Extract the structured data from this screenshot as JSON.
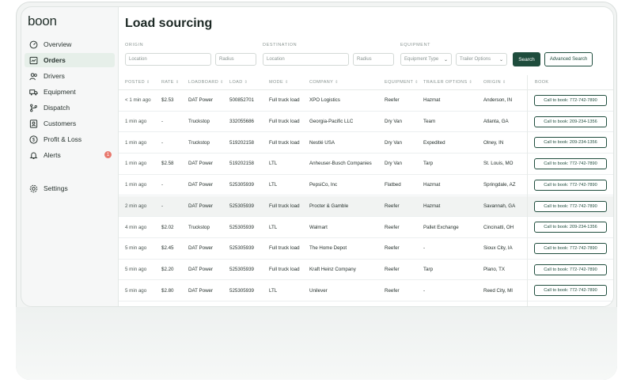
{
  "app": {
    "logo": "boon"
  },
  "sidebar": {
    "items": [
      {
        "label": "Overview",
        "icon": "overview-icon"
      },
      {
        "label": "Orders",
        "icon": "orders-icon",
        "active": true
      },
      {
        "label": "Drivers",
        "icon": "drivers-icon"
      },
      {
        "label": "Equipment",
        "icon": "truck-icon"
      },
      {
        "label": "Dispatch",
        "icon": "dispatch-icon"
      },
      {
        "label": "Customers",
        "icon": "customers-icon"
      },
      {
        "label": "Profit & Loss",
        "icon": "dollar-icon"
      },
      {
        "label": "Alerts",
        "icon": "bell-icon",
        "badge": "1"
      }
    ],
    "settings": {
      "label": "Settings",
      "icon": "gear-icon"
    }
  },
  "main": {
    "title": "Load sourcing",
    "filters": {
      "origin_label": "Origin",
      "destination_label": "Destination",
      "equipment_label": "Equipment",
      "origin_location_placeholder": "Location",
      "origin_radius_placeholder": "Radius",
      "destination_location_placeholder": "Location",
      "destination_radius_placeholder": "Radius",
      "equipment_type": "Equipment Type",
      "trailer_options": "Trailer Options",
      "search_button": "Search",
      "advanced_button": "Advanced Search"
    },
    "columns": [
      "Posted",
      "Rate",
      "Loadboard",
      "Load",
      "Mode",
      "Company",
      "Equipment",
      "Trailer Options",
      "Origin",
      "Book"
    ],
    "rows": [
      {
        "posted": "< 1 min ago",
        "rate": "$2.53",
        "loadboard": "DAT Power",
        "load": "500852701",
        "mode": "Full truck load",
        "company": "XPO Logistics",
        "equipment": "Reefer",
        "trailer": "Hazmat",
        "origin": "Anderson, IN",
        "book": "Call to book:  772-742-7890"
      },
      {
        "posted": "1 min ago",
        "rate": "-",
        "loadboard": "Truckstop",
        "load": "332055686",
        "mode": "Full truck load",
        "company": "Georgia-Pacific LLC",
        "equipment": "Dry Van",
        "trailer": "Team",
        "origin": "Atlanta, GA",
        "book": "Call to book:  209-234-1356"
      },
      {
        "posted": "1 min ago",
        "rate": "-",
        "loadboard": "Truckstop",
        "load": "519202158",
        "mode": "Full truck load",
        "company": "Nestlé USA",
        "equipment": "Dry Van",
        "trailer": "Expedited",
        "origin": "Olney, IN",
        "book": "Call to book:  209-234-1356"
      },
      {
        "posted": "1 min ago",
        "rate": "$2.58",
        "loadboard": "DAT Power",
        "load": "519202158",
        "mode": "LTL",
        "company": "Anheuser-Busch Companies",
        "equipment": "Dry Van",
        "trailer": "Tarp",
        "origin": "St. Louis, MO",
        "book": "Call to book:  772-742-7890"
      },
      {
        "posted": "1 min ago",
        "rate": "-",
        "loadboard": "DAT Power",
        "load": "525305939",
        "mode": "LTL",
        "company": "PepsiCo, Inc",
        "equipment": "Flatbed",
        "trailer": "Hazmat",
        "origin": "Springdale, AZ",
        "book": "Call to book:  772-742-7890"
      },
      {
        "posted": "2 min ago",
        "rate": "-",
        "loadboard": "DAT Power",
        "load": "525305939",
        "mode": "Full truck load",
        "company": "Procter & Gamble",
        "equipment": "Reefer",
        "trailer": "Hazmat",
        "origin": "Savannah, GA",
        "book": "Call to book:  772-742-7890"
      },
      {
        "posted": "4 min ago",
        "rate": "$2.02",
        "loadboard": "Truckstop",
        "load": "525305939",
        "mode": "LTL",
        "company": "Walmart",
        "equipment": "Reefer",
        "trailer": "Pallet Exchange",
        "origin": "Cincinatti, OH",
        "book": "Call to book:  209-234-1356"
      },
      {
        "posted": "5 min ago",
        "rate": "$2.45",
        "loadboard": "DAT Power",
        "load": "525305939",
        "mode": "Full truck load",
        "company": "The Home Depot",
        "equipment": "Reefer",
        "trailer": "-",
        "origin": "Sioux City, IA",
        "book": "Call to book:  772-742-7890"
      },
      {
        "posted": "5 min ago",
        "rate": "$2.20",
        "loadboard": "DAT Power",
        "load": "525305939",
        "mode": "Full truck load",
        "company": "Kraft Heinz Company",
        "equipment": "Reefer",
        "trailer": "Tarp",
        "origin": "Plano, TX",
        "book": "Call to book:  772-742-7890"
      },
      {
        "posted": "5 min ago",
        "rate": "$2.80",
        "loadboard": "DAT Power",
        "load": "525305939",
        "mode": "LTL",
        "company": "Unilever",
        "equipment": "Reefer",
        "trailer": "-",
        "origin": "Reed City, MI",
        "book": "Call to book:  772-742-7890"
      }
    ]
  },
  "colors": {
    "accent": "#1f4d3d",
    "active_nav": "#e6efe9",
    "badge": "#e8796e"
  }
}
